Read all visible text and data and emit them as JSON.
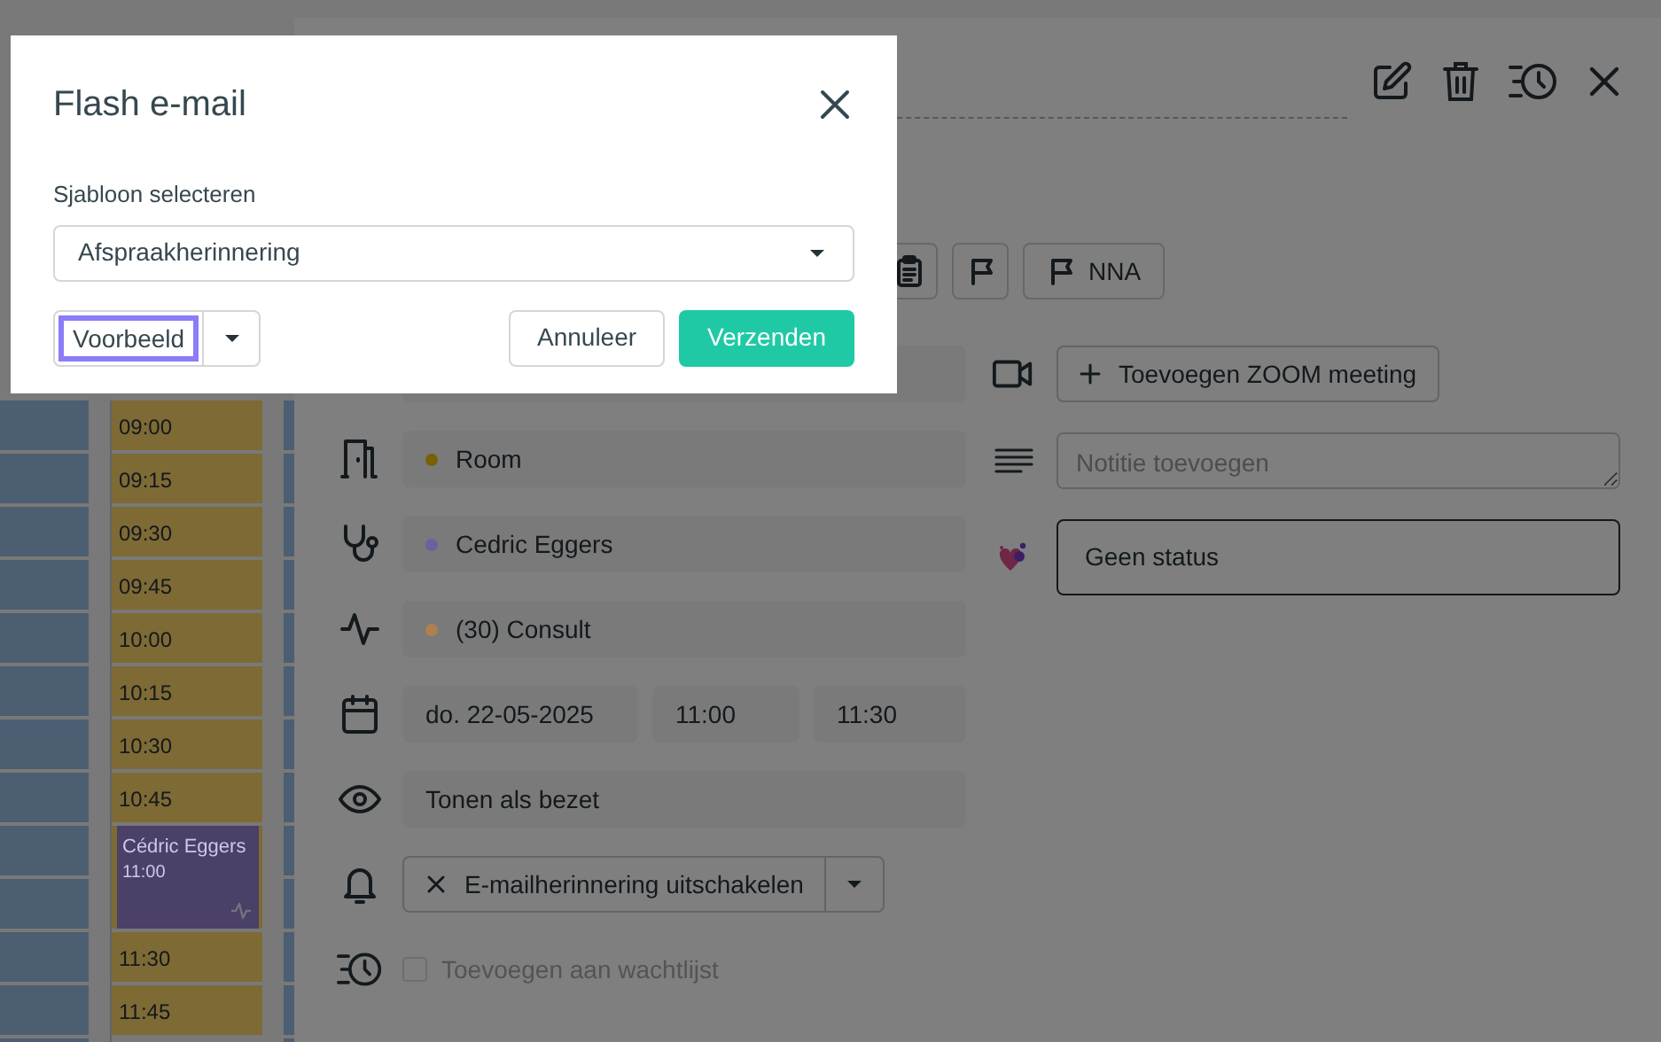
{
  "dialog": {
    "title": "Flash e-mail",
    "template_label": "Sjabloon selecteren",
    "template_value": "Afspraakherinnering",
    "preview_button": "Voorbeeld",
    "cancel_button": "Annuleer",
    "send_button": "Verzenden"
  },
  "calendar": {
    "slots": [
      {
        "kind": "slot",
        "time": "09:00"
      },
      {
        "kind": "slot",
        "time": "09:15"
      },
      {
        "kind": "slot",
        "time": "09:30"
      },
      {
        "kind": "slot",
        "time": "09:45"
      },
      {
        "kind": "slot",
        "time": "10:00"
      },
      {
        "kind": "slot",
        "time": "10:15"
      },
      {
        "kind": "slot",
        "time": "10:30"
      },
      {
        "kind": "slot",
        "time": "10:45"
      },
      {
        "kind": "event",
        "name": "Cédric Eggers",
        "time": "11:00"
      },
      {
        "kind": "slot",
        "time": "11:30"
      },
      {
        "kind": "slot",
        "time": "11:45"
      }
    ]
  },
  "tag_buttons": [
    {
      "kind": "clipboard"
    },
    {
      "kind": "flag"
    },
    {
      "kind": "flag",
      "label": "NNA"
    }
  ],
  "appointment": {
    "zoom_button": "Toevoegen ZOOM meeting",
    "room": {
      "label": "Room",
      "color": "#7a6000"
    },
    "practitioner": {
      "label": "Cedric Eggers",
      "color": "#6e5fa0"
    },
    "type": {
      "label": "(30) Consult",
      "color": "#b08050"
    },
    "date": "do. 22-05-2025",
    "start": "11:00",
    "end": "11:30",
    "visibility": "Tonen als bezet",
    "reminder": "E-mailherinnering uitschakelen",
    "waitlist": {
      "label": "Toevoegen aan wachtlijst",
      "checked": false,
      "disabled": true
    },
    "note_placeholder": "Notitie toevoegen",
    "status": "Geen status"
  }
}
